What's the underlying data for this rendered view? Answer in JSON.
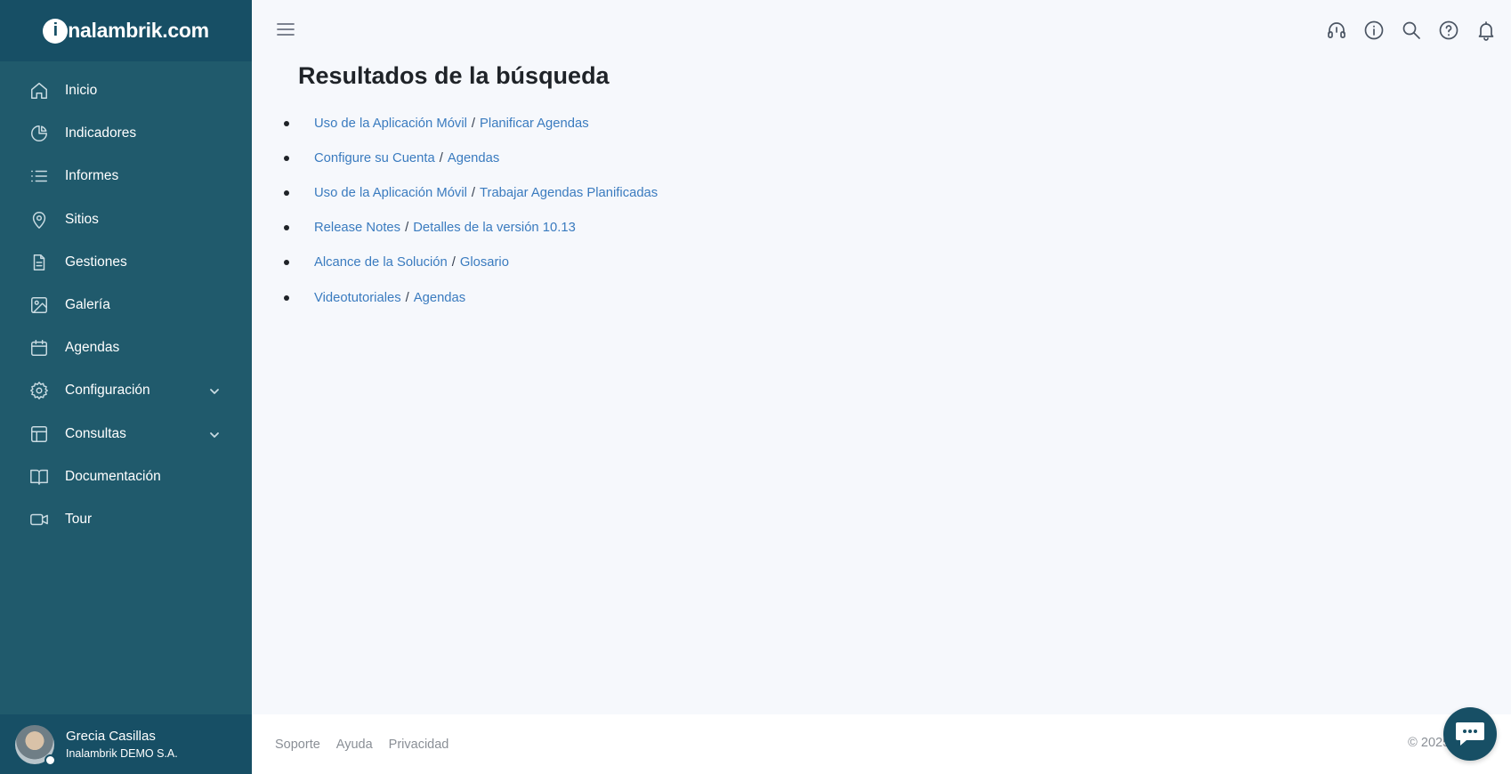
{
  "brand": {
    "logo_letter": "i",
    "logo_text": "nalambrik.com"
  },
  "sidebar": {
    "items": [
      {
        "label": "Inicio",
        "icon": "home-icon"
      },
      {
        "label": "Indicadores",
        "icon": "pie-chart-icon"
      },
      {
        "label": "Informes",
        "icon": "list-icon"
      },
      {
        "label": "Sitios",
        "icon": "map-pin-icon"
      },
      {
        "label": "Gestiones",
        "icon": "document-icon"
      },
      {
        "label": "Galería",
        "icon": "image-icon"
      },
      {
        "label": "Agendas",
        "icon": "calendar-icon"
      },
      {
        "label": "Configuración",
        "icon": "gear-icon",
        "expandable": true
      },
      {
        "label": "Consultas",
        "icon": "table-icon",
        "expandable": true
      },
      {
        "label": "Documentación",
        "icon": "book-icon"
      },
      {
        "label": "Tour",
        "icon": "video-icon"
      }
    ],
    "user": {
      "name": "Grecia Casillas",
      "company": "Inalambrik DEMO S.A."
    }
  },
  "topbar": {
    "icons": [
      "headset-icon",
      "info-icon",
      "search-icon",
      "help-icon",
      "bell-icon"
    ]
  },
  "main": {
    "title": "Resultados de la búsqueda",
    "results": [
      {
        "section": "Uso de la Aplicación Móvil",
        "page": "Planificar Agendas"
      },
      {
        "section": "Configure su Cuenta",
        "page": "Agendas"
      },
      {
        "section": "Uso de la Aplicación Móvil",
        "page": "Trabajar Agendas Planificadas"
      },
      {
        "section": "Release Notes",
        "page": "Detalles de la versión 10.13"
      },
      {
        "section": "Alcance de la Solución",
        "page": "Glosario"
      },
      {
        "section": "Videotutoriales",
        "page": "Agendas"
      }
    ],
    "separator": "/"
  },
  "footer": {
    "links": [
      "Soporte",
      "Ayuda",
      "Privacidad"
    ],
    "copyright": "© 2025 -"
  },
  "colors": {
    "sidebar": "#205a6c",
    "sidebar_dark": "#174f65",
    "link": "#3a7bbf",
    "background": "#f6f8fc"
  }
}
